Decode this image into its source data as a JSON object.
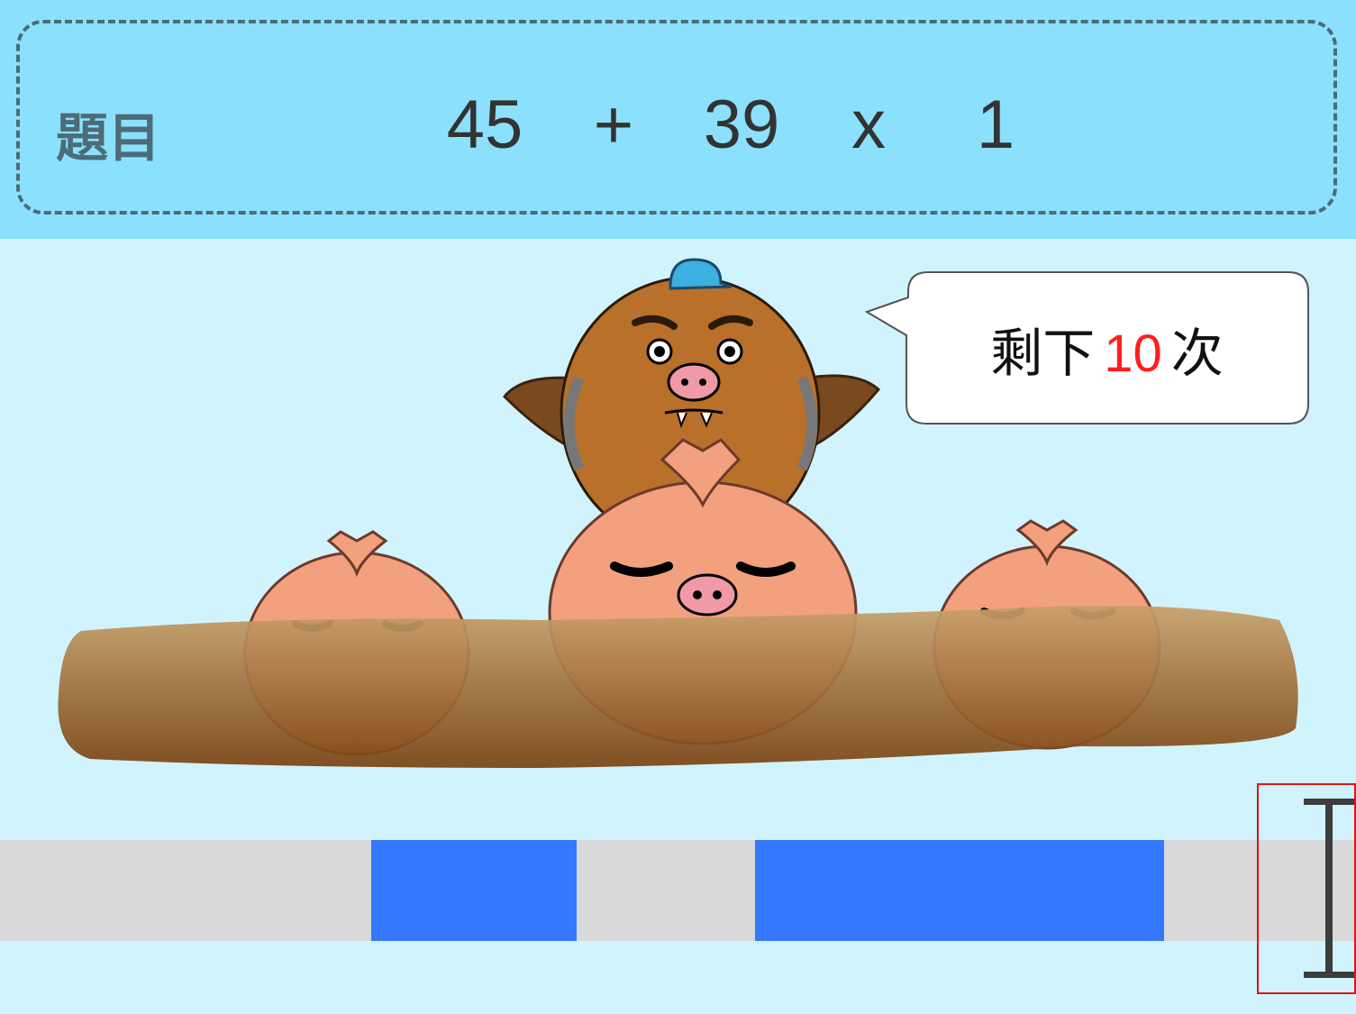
{
  "question": {
    "label": "題目",
    "terms": [
      "45",
      "+",
      "39",
      "x",
      "1"
    ]
  },
  "bubble": {
    "prefix": "剩下",
    "count": "10",
    "suffix": "次"
  },
  "colors": {
    "header_bg": "#8be1fd",
    "scene_bg": "#d1f3fd",
    "target_zone": "#3478ff",
    "count_highlight": "#ff1e1e",
    "selection_outline": "#e01515"
  },
  "icons": [
    "cursor-marker-icon",
    "mole-boss-icon",
    "onion-pig-icon"
  ]
}
